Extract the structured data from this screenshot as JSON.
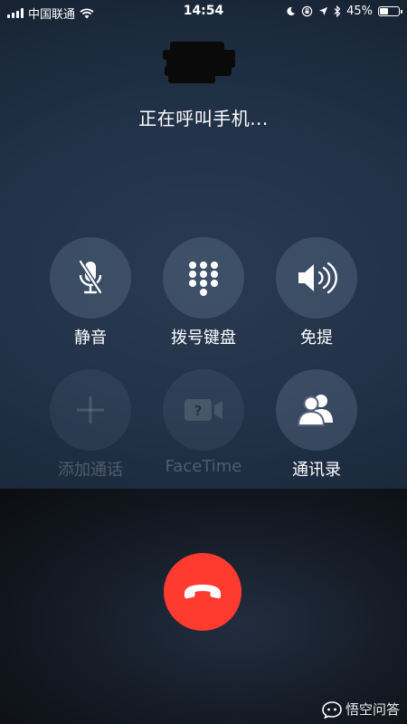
{
  "status_bar": {
    "carrier": "中国联通",
    "time": "14:54",
    "battery_percent": "45%",
    "battery_level": 0.45
  },
  "call": {
    "status": "正在呼叫手机..."
  },
  "controls": {
    "mute": "静音",
    "keypad": "拨号键盘",
    "speaker": "免提",
    "add_call": "添加通话",
    "facetime": "FaceTime",
    "contacts": "通讯录"
  },
  "watermark": {
    "text": "悟空问答"
  },
  "colors": {
    "end_call": "#ff3b30",
    "button_bg": "#4c5a6e"
  }
}
